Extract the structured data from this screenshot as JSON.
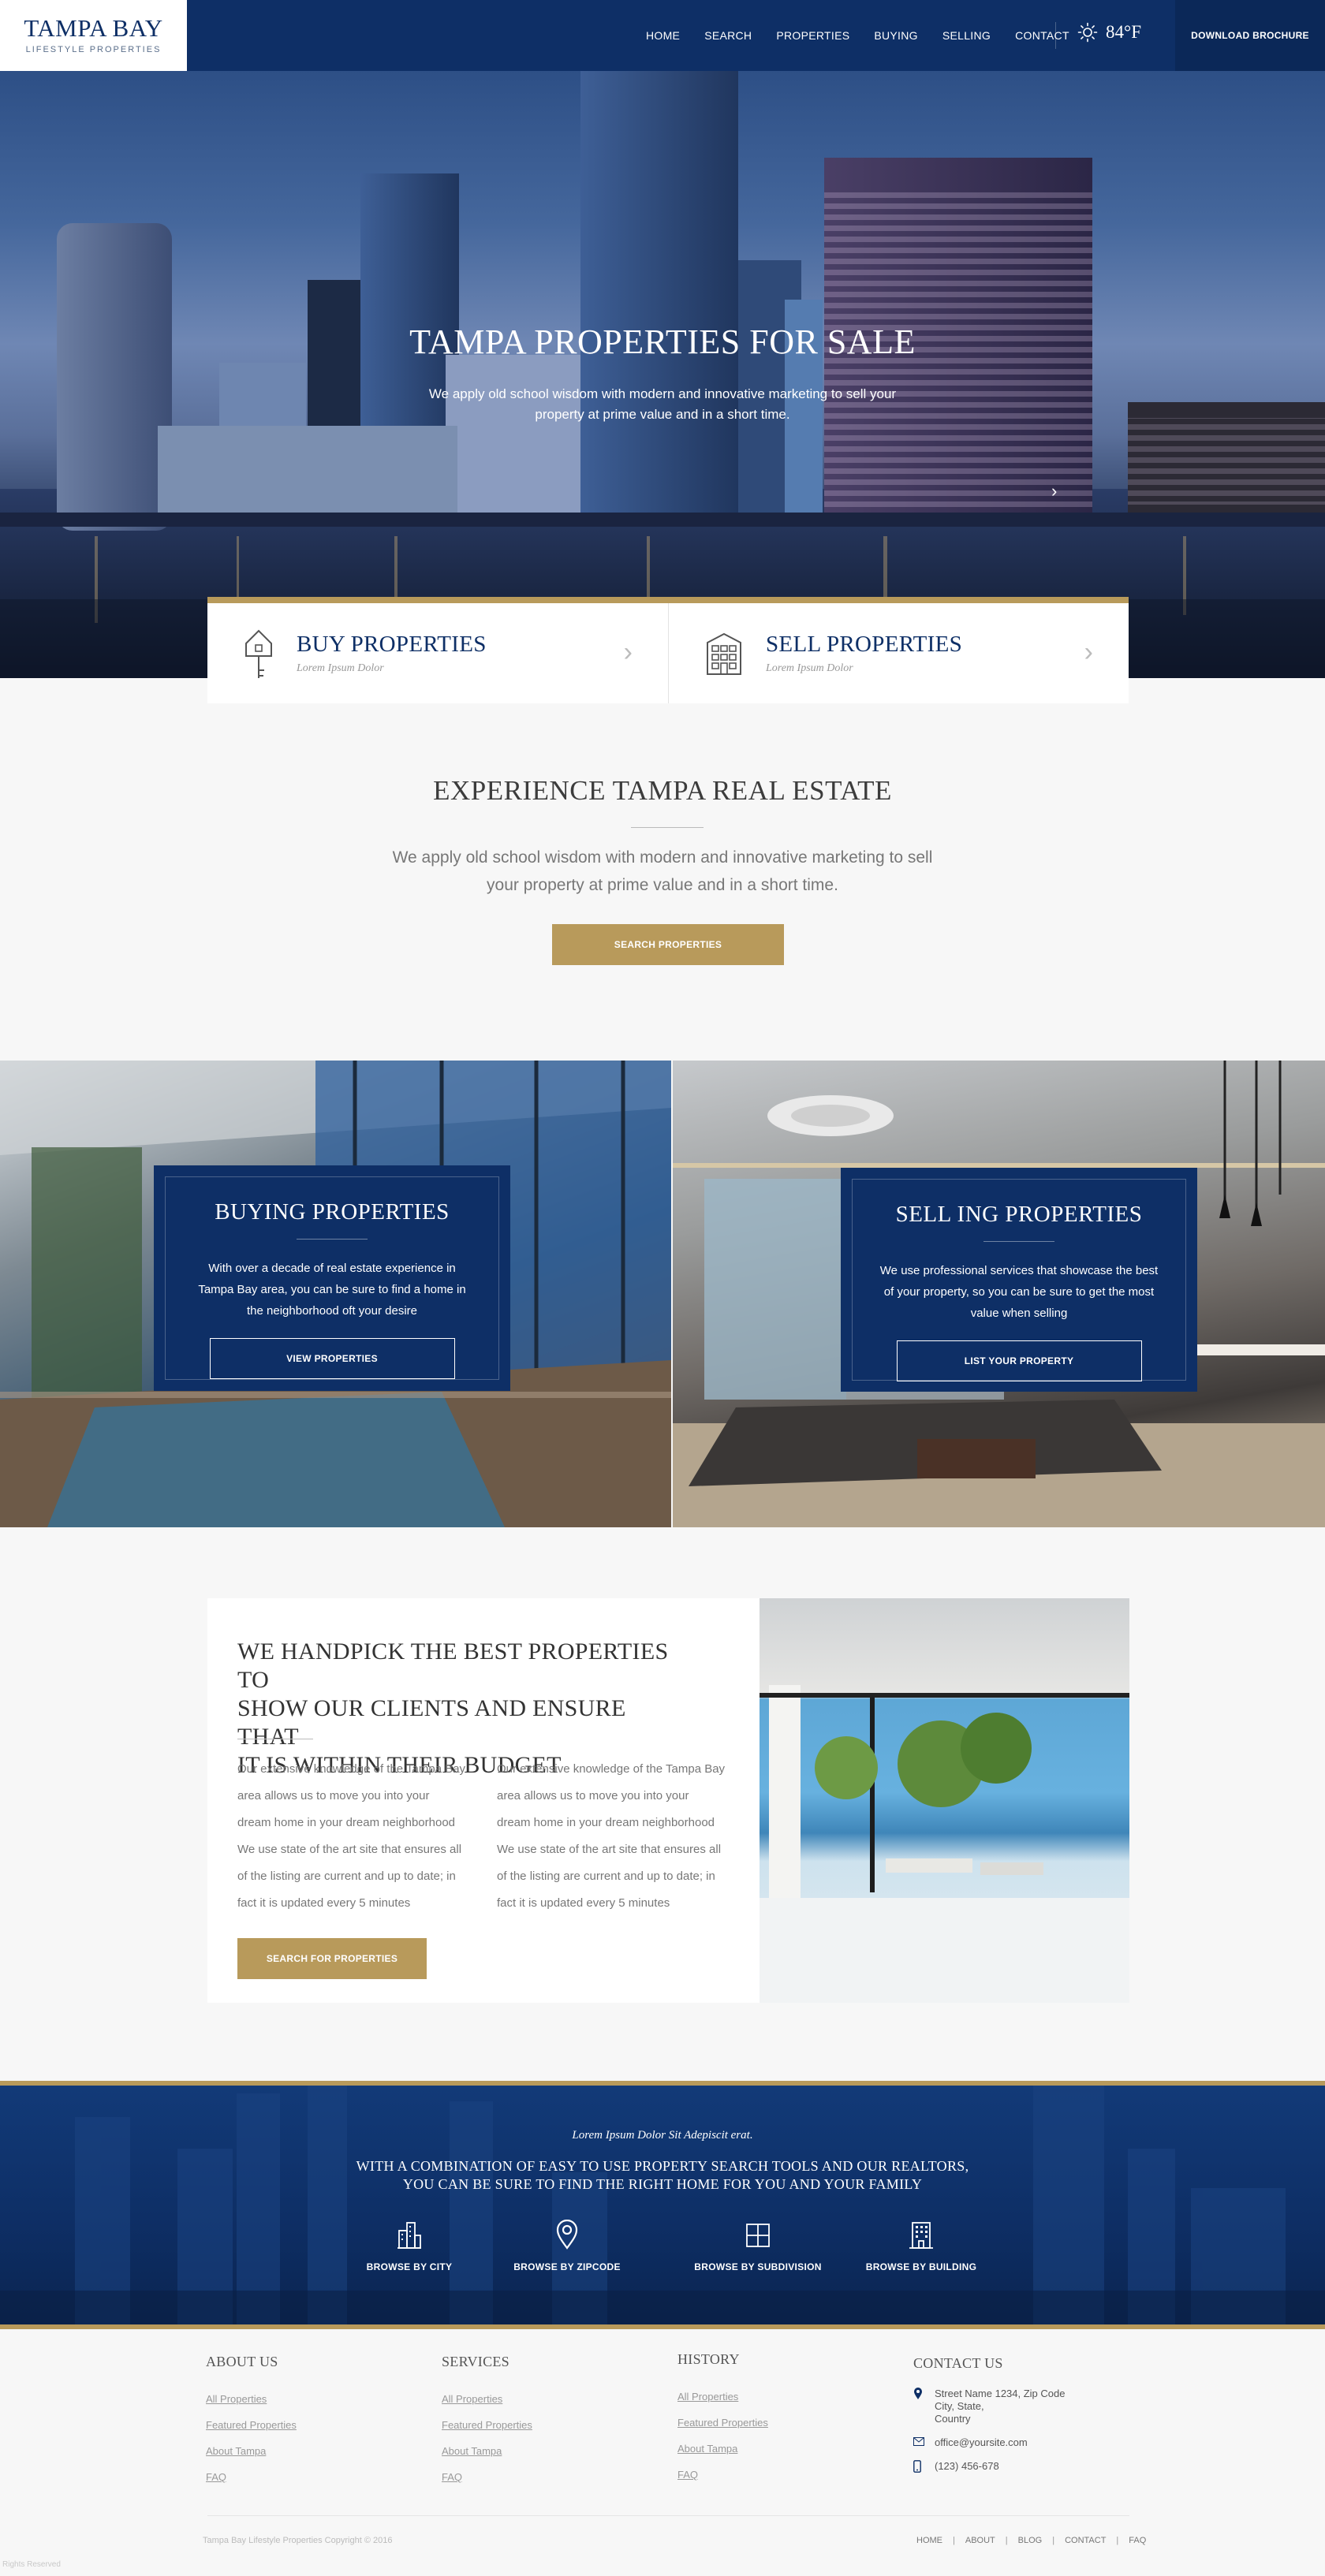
{
  "header": {
    "logo_title": "TAMPA BAY",
    "logo_subtitle": "LIFESTYLE PROPERTIES",
    "nav": [
      "HOME",
      "SEARCH",
      "PROPERTIES",
      "BUYING",
      "SELLING",
      "CONTACT"
    ],
    "weather_icon": "sun-icon",
    "temperature": "84°F",
    "brochure_button": "DOWNLOAD BROCHURE"
  },
  "hero": {
    "title": "TAMPA PROPERTIES FOR SALE",
    "subtitle": "We apply old school wisdom with modern and innovative marketing to sell your property at prime value and in a short time."
  },
  "buy_sell": [
    {
      "title": "BUY PROPERTIES",
      "subtitle": "Lorem Ipsum Dolor",
      "icon": "house-key-icon"
    },
    {
      "title": "SELL PROPERTIES",
      "subtitle": "Lorem Ipsum Dolor",
      "icon": "building-icon"
    }
  ],
  "experience": {
    "title": "EXPERIENCE TAMPA REAL ESTATE",
    "text": "We apply old school wisdom with modern and innovative marketing to sell your property at prime value and in a short time.",
    "button": "SEARCH PROPERTIES"
  },
  "panels": [
    {
      "title": "BUYING  PROPERTIES",
      "text": "With over a decade of real estate experience in Tampa Bay area, you can be sure to find a home in the neighborhood oft your desire",
      "button": "VIEW PROPERTIES"
    },
    {
      "title": "SELL ING PROPERTIES",
      "text": "We use professional services that showcase the best of your property, so you can be sure to get the most value when selling",
      "button": "LIST YOUR PROPERTY"
    }
  ],
  "handpick": {
    "title_lines": [
      "WE HANDPICK THE BEST PROPERTIES TO",
      "SHOW OUR CLIENTS AND ENSURE THAT",
      "IT IS WITHIN THEIR BUDGET"
    ],
    "col1": [
      "Our extensive knowledge of the Tampa Bay area allows us to move you into your dream home in your dream neighborhood",
      "We use state of the art site that ensures all of the listing are current and up to date; in fact it is updated every 5 minutes"
    ],
    "col2": [
      "Our extensive knowledge of the Tampa Bay area allows us to move you into your dream home in your dream neighborhood",
      "We use state of the art site that ensures all of the listing are current and up to date; in fact it is updated every 5 minutes"
    ],
    "button": "SEARCH FOR PROPERTIES"
  },
  "band": {
    "tagline": "Lorem Ipsum Dolor Sit Adepiscit erat.",
    "title_lines": [
      "WITH A COMBINATION OF EASY TO USE PROPERTY SEARCH TOOLS AND OUR REALTORS,",
      "YOU CAN BE SURE TO FIND THE RIGHT HOME FOR YOU AND YOUR FAMILY"
    ],
    "items": [
      {
        "label": "BROWSE BY CITY",
        "icon": "city-icon"
      },
      {
        "label": "BROWSE BY ZIPCODE",
        "icon": "map-pin-icon"
      },
      {
        "label": "BROWSE BY SUBDIVISION",
        "icon": "grid-icon"
      },
      {
        "label": "BROWSE BY BUILDING",
        "icon": "building-icon"
      }
    ]
  },
  "footer": {
    "about": {
      "heading": "ABOUT US",
      "links": [
        "All  Properties",
        "Featured Properties",
        "About Tampa",
        "FAQ"
      ]
    },
    "services": {
      "heading": "SERVICES",
      "links": [
        "All  Properties",
        "Featured Properties",
        "About Tampa",
        "FAQ"
      ]
    },
    "history": {
      "heading": "HISTORY",
      "links": [
        "All  Properties",
        "Featured Properties",
        "About Tampa",
        "FAQ"
      ]
    },
    "contact": {
      "heading": "CONTACT US",
      "address_lines": [
        "Street Name 1234, Zip Code",
        "City, State,",
        "Country"
      ],
      "email": "office@yoursite.com",
      "phone": "(123) 456-678"
    },
    "copyright": "Tampa Bay Lifestyle Properties Copyright © 2016",
    "bottom_nav": [
      "HOME",
      "ABOUT",
      "BLOG",
      "CONTACT",
      "FAQ"
    ],
    "rights": "Rights Reserved"
  },
  "colors": {
    "navy": "#0e2f66",
    "gold": "#b89a5b",
    "background": "#f7f7f7"
  }
}
